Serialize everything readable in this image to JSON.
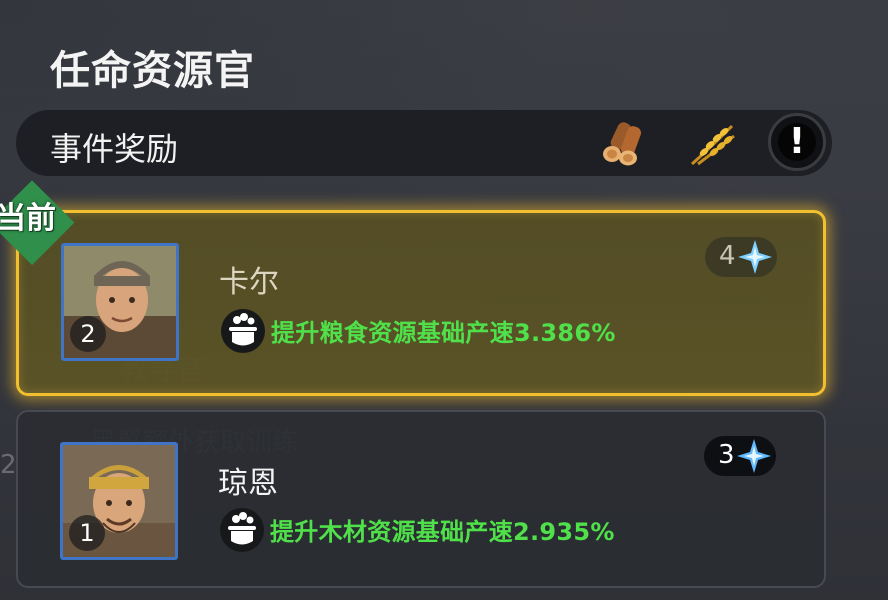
{
  "title": "任命资源官",
  "reward_bar": {
    "label": "事件奖励",
    "icons": [
      "wood-logs-icon",
      "wheat-icon",
      "alert-icon"
    ]
  },
  "current_badge": "当前",
  "officers": [
    {
      "name": "卡尔",
      "rank": "2",
      "stars": "4",
      "skill_icon": "cooking-pot-icon",
      "skill": "提升粮食资源基础产速3.386%",
      "state": "current"
    },
    {
      "name": "琼恩",
      "rank": "1",
      "stars": "3",
      "skill_icon": "cooking-pot-icon",
      "skill": "提升木材资源基础产速2.935%",
      "state": "normal"
    }
  ],
  "background_ghost": {
    "line1": "教导官",
    "line2": "黑翼额外获取训练",
    "line3": "2"
  },
  "colors": {
    "accent_gold": "#f2bf2e",
    "skill_green": "#4fe04a",
    "badge_green": "#2f8f4b",
    "portrait_border": "#3f74c6"
  }
}
